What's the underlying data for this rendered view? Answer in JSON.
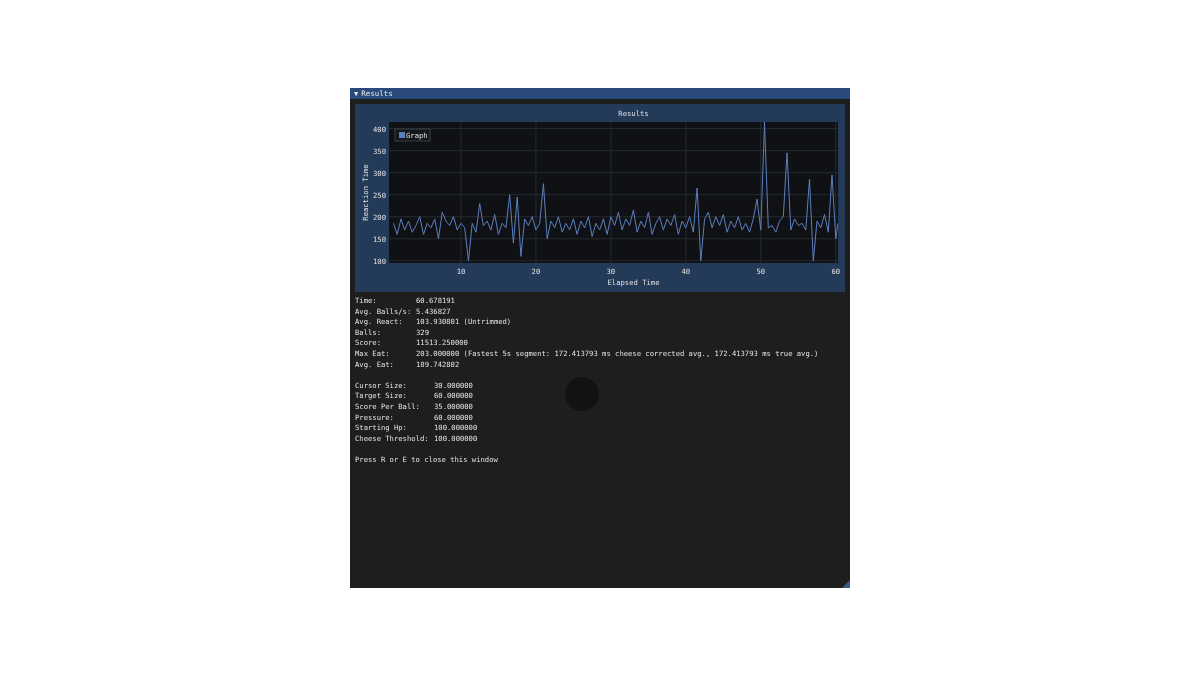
{
  "window": {
    "title": "Results",
    "collapse_glyph": "▼"
  },
  "chart": {
    "chart_data": {
      "type": "line",
      "title": "Results",
      "xlabel": "Elapsed Time",
      "ylabel": "Reaction Time",
      "xlim": [
        0.4,
        60.3
      ],
      "ylim": [
        95,
        415
      ],
      "xticks": [
        10,
        20,
        30,
        40,
        50,
        60
      ],
      "yticks": [
        100,
        150,
        200,
        250,
        300,
        350,
        400
      ],
      "grid": true,
      "x": [
        1,
        1.5,
        2,
        2.5,
        3,
        3.5,
        4,
        4.5,
        5,
        5.5,
        6,
        6.5,
        7,
        7.5,
        8,
        8.5,
        9,
        9.5,
        10,
        10.5,
        11,
        11.5,
        12,
        12.5,
        13,
        13.5,
        14,
        14.5,
        15,
        15.5,
        16,
        16.5,
        17,
        17.5,
        18,
        18.5,
        19,
        19.5,
        20,
        20.5,
        21,
        21.5,
        22,
        22.5,
        23,
        23.5,
        24,
        24.5,
        25,
        25.5,
        26,
        26.5,
        27,
        27.5,
        28,
        28.5,
        29,
        29.5,
        30,
        30.5,
        31,
        31.5,
        32,
        32.5,
        33,
        33.5,
        34,
        34.5,
        35,
        35.5,
        36,
        36.5,
        37,
        37.5,
        38,
        38.5,
        39,
        39.5,
        40,
        40.5,
        41,
        41.5,
        42,
        42.5,
        43,
        43.5,
        44,
        44.5,
        45,
        45.5,
        46,
        46.5,
        47,
        47.5,
        48,
        48.5,
        49,
        49.5,
        50,
        50.5,
        51,
        51.5,
        52,
        52.5,
        53,
        53.5,
        54,
        54.5,
        55,
        55.5,
        56,
        56.5,
        57,
        57.5,
        58,
        58.5,
        59,
        59.5,
        60,
        60.3
      ],
      "series": [
        {
          "name": "Graph",
          "color": "#5b7fbf",
          "values": [
            185,
            160,
            195,
            170,
            190,
            165,
            180,
            200,
            160,
            185,
            175,
            195,
            150,
            210,
            190,
            180,
            200,
            170,
            185,
            175,
            100,
            185,
            165,
            230,
            180,
            190,
            170,
            205,
            160,
            185,
            175,
            250,
            140,
            245,
            110,
            195,
            180,
            200,
            170,
            185,
            275,
            150,
            190,
            175,
            200,
            165,
            185,
            170,
            195,
            160,
            190,
            175,
            200,
            155,
            185,
            170,
            195,
            160,
            200,
            180,
            210,
            170,
            195,
            180,
            215,
            165,
            190,
            175,
            210,
            160,
            185,
            200,
            170,
            195,
            180,
            205,
            160,
            190,
            175,
            200,
            165,
            265,
            100,
            195,
            210,
            175,
            200,
            180,
            205,
            165,
            190,
            175,
            200,
            170,
            185,
            165,
            195,
            240,
            170,
            415,
            175,
            180,
            165,
            190,
            200,
            345,
            170,
            195,
            180,
            185,
            170,
            285,
            100,
            190,
            175,
            205,
            165,
            295,
            150,
            185
          ]
        }
      ]
    }
  },
  "stats": [
    {
      "label": "Time:",
      "value": "60.678191"
    },
    {
      "label": "Avg. Balls/s:",
      "value": "5.436827"
    },
    {
      "label": "Avg. React:",
      "value": "103.930801 (Untrimmed)"
    },
    {
      "label": "Balls:",
      "value": "329"
    },
    {
      "label": "Score:",
      "value": "11513.250000"
    },
    {
      "label": "Max Eat:",
      "value": "203.000000 (Fastest 5s segment: 172.413793 ms cheese corrected avg., 172.413793 ms true avg.)"
    },
    {
      "label": "Avg. Eat:",
      "value": "189.742802"
    }
  ],
  "settings": [
    {
      "label": "Cursor Size:",
      "value": "30.000000"
    },
    {
      "label": "Target Size:",
      "value": "60.000000"
    },
    {
      "label": "Score Per Ball:",
      "value": "35.000000"
    },
    {
      "label": "Pressure:",
      "value": "60.000000"
    },
    {
      "label": "Starting Hp:",
      "value": "100.000000"
    },
    {
      "label": "Cheese Threshold:",
      "value": "100.000000"
    }
  ],
  "hint": "Press R or E to close this window"
}
